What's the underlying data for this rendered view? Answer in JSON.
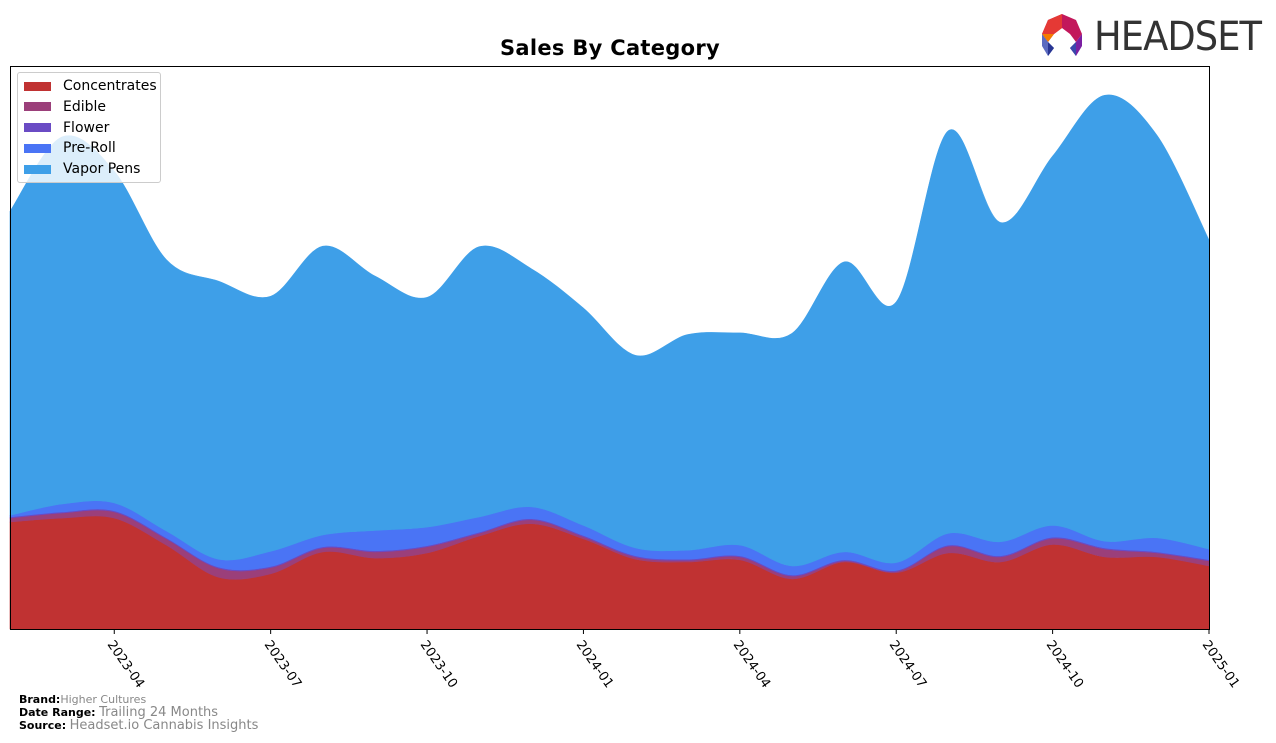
{
  "header": {
    "title": "Sales By Category",
    "logo_text": "HEADSET"
  },
  "footer": {
    "brand_label": "Brand:",
    "brand_value": "Higher Cultures",
    "date_range_label": "Date Range:",
    "date_range_value": "Trailing 24 Months",
    "source_label": "Source:",
    "source_value": "Headset.io Cannabis Insights"
  },
  "chart_data": {
    "type": "area",
    "stacked": true,
    "smooth": true,
    "title": "Sales By Category",
    "xlabel": "",
    "ylabel": "",
    "y_axis_visible": false,
    "grid": false,
    "legend_position": "top-left",
    "ylim": [
      0,
      100
    ],
    "x": [
      "2023-02",
      "2023-03",
      "2023-04",
      "2023-05",
      "2023-06",
      "2023-07",
      "2023-08",
      "2023-09",
      "2023-10",
      "2023-11",
      "2023-12",
      "2024-01",
      "2024-02",
      "2024-03",
      "2024-04",
      "2024-05",
      "2024-06",
      "2024-07",
      "2024-08",
      "2024-09",
      "2024-10",
      "2024-11",
      "2024-12",
      "2025-01"
    ],
    "xticks": [
      "2023-04",
      "2023-07",
      "2023-10",
      "2024-01",
      "2024-04",
      "2024-07",
      "2024-10",
      "2025-01"
    ],
    "series": [
      {
        "name": "Concentrates",
        "color": "#c03232",
        "values": [
          19.0,
          19.7,
          19.7,
          14.9,
          9.2,
          9.8,
          13.7,
          12.6,
          13.5,
          16.5,
          18.7,
          16.0,
          12.4,
          11.9,
          12.3,
          8.9,
          11.9,
          10.0,
          13.5,
          11.9,
          15.0,
          12.8,
          12.8,
          11.2
        ]
      },
      {
        "name": "Edible",
        "color": "#9b3f7a",
        "values": [
          0.7,
          0.9,
          1.1,
          1.1,
          1.6,
          1.1,
          0.7,
          1.1,
          1.1,
          0.5,
          0.7,
          0.4,
          0.4,
          0.3,
          0.5,
          0.5,
          0.2,
          0.2,
          1.2,
          0.9,
          1.1,
          1.4,
          0.7,
          0.9
        ]
      },
      {
        "name": "Flower",
        "color": "#6a4bc4",
        "values": [
          0.2,
          0.2,
          0.2,
          0.2,
          0.2,
          0.2,
          0.2,
          0.2,
          0.2,
          0.2,
          0.2,
          0.2,
          0.2,
          0.2,
          0.2,
          0.2,
          0.2,
          0.2,
          0.2,
          0.2,
          0.2,
          0.2,
          0.2,
          0.2
        ]
      },
      {
        "name": "Pre-Roll",
        "color": "#4a74f5",
        "values": [
          0.3,
          1.4,
          1.4,
          1.2,
          1.4,
          2.7,
          2.1,
          3.6,
          3.3,
          2.7,
          2.1,
          1.8,
          1.4,
          1.6,
          1.9,
          1.6,
          1.4,
          1.4,
          2.1,
          2.5,
          2.1,
          1.2,
          2.5,
          1.9
        ]
      },
      {
        "name": "Vapor Pens",
        "color": "#3e9fe8",
        "values": [
          54.0,
          65.2,
          58.9,
          48.2,
          49.4,
          45.3,
          51.3,
          45.2,
          40.8,
          48.0,
          42.3,
          38.6,
          34.2,
          38.3,
          37.7,
          41.3,
          51.5,
          46.3,
          71.5,
          56.7,
          65.6,
          79.2,
          71.5,
          54.9
        ]
      }
    ]
  }
}
